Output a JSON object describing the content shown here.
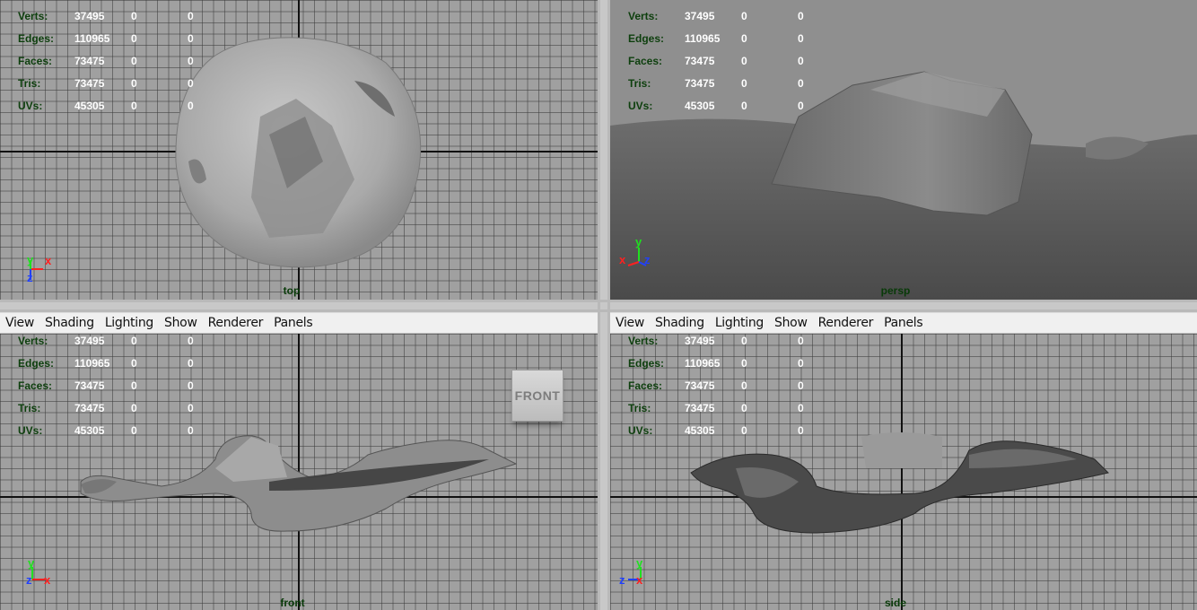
{
  "stats": {
    "rows": [
      {
        "label": "Verts:",
        "v1": "37495",
        "v2": "0",
        "v3": "0"
      },
      {
        "label": "Edges:",
        "v1": "110965",
        "v2": "0",
        "v3": "0"
      },
      {
        "label": "Faces:",
        "v1": "73475",
        "v2": "0",
        "v3": "0"
      },
      {
        "label": "Tris:",
        "v1": "73475",
        "v2": "0",
        "v3": "0"
      },
      {
        "label": "UVs:",
        "v1": "45305",
        "v2": "0",
        "v3": "0"
      }
    ]
  },
  "menu": [
    "View",
    "Shading",
    "Lighting",
    "Show",
    "Renderer",
    "Panels"
  ],
  "viewports": {
    "top": {
      "camera": "top",
      "axes": {
        "a": "y",
        "b": "x",
        "c": "z"
      }
    },
    "persp": {
      "camera": "persp",
      "axes": {
        "a": "y",
        "b": "x",
        "c": "z"
      }
    },
    "front": {
      "camera": "front",
      "axes": {
        "a": "y",
        "b": "z",
        "c": "x"
      },
      "cube_label": "FRONT"
    },
    "side": {
      "camera": "side",
      "axes": {
        "a": "y",
        "b": "z",
        "c": "x"
      }
    }
  },
  "colors": {
    "axis_x": "#ff2020",
    "axis_y": "#20e020",
    "axis_z": "#2040ff",
    "label": "#083a08"
  }
}
